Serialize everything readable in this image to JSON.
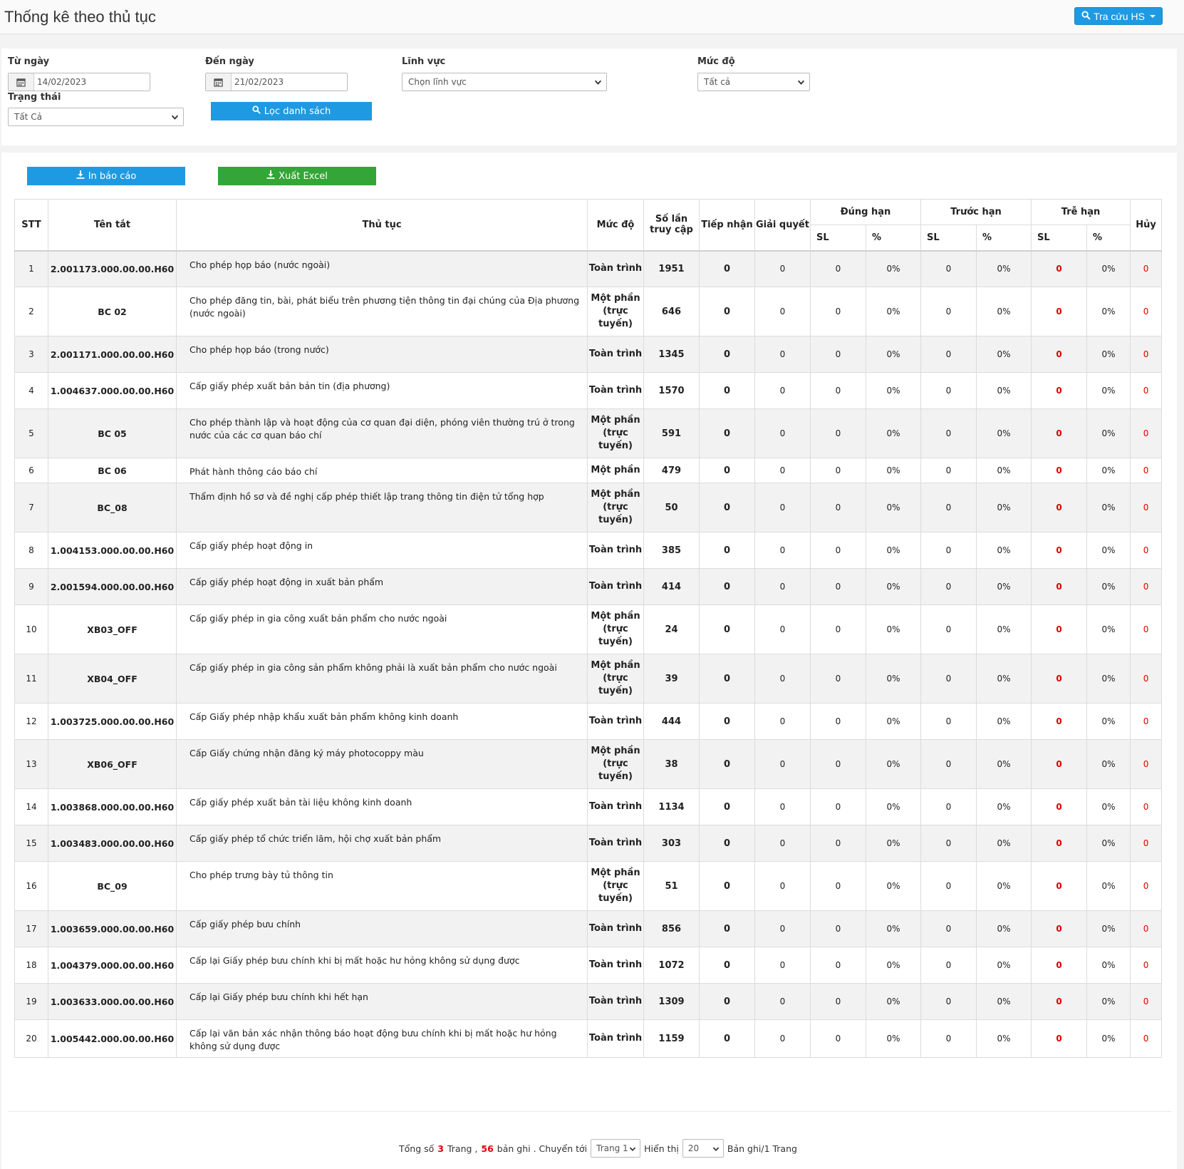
{
  "header": {
    "title": "Thống kê theo thủ tục",
    "lookup_button": "Tra cứu HS"
  },
  "filters": {
    "from_label": "Từ ngày",
    "from_value": "14/02/2023",
    "to_label": "Đến ngày",
    "to_value": "21/02/2023",
    "field_label": "Lĩnh vực",
    "field_value": "Chọn lĩnh vực",
    "level_label": "Mức độ",
    "level_value": "Tất cả",
    "status_label": "Trạng thái",
    "status_value": "Tất Cả",
    "filter_button": "Lọc danh sách"
  },
  "actions": {
    "print_button": "In báo cáo",
    "excel_button": "Xuất Excel"
  },
  "table": {
    "headers": {
      "stt": "STT",
      "code": "Tên tắt",
      "procedure": "Thủ tục",
      "level": "Mức độ",
      "access": "Số lần truy cập",
      "received": "Tiếp nhận",
      "resolved": "Giải quyết",
      "ontime": "Đúng hạn",
      "early": "Trước hạn",
      "late": "Trễ hạn",
      "cancel": "Hủy",
      "sl": "SL",
      "pct": "%"
    },
    "rows": [
      {
        "stt": "1",
        "code": "2.001173.000.00.00.H60",
        "procedure": "Cho phép họp báo (nước ngoài)",
        "level": "Toàn trình",
        "access": "1951",
        "received": "0",
        "resolved": "0",
        "ontime_sl": "0",
        "ontime_pct": "0%",
        "early_sl": "0",
        "early_pct": "0%",
        "late_sl": "0",
        "late_pct": "0%",
        "cancel": "0"
      },
      {
        "stt": "2",
        "code": "BC 02",
        "procedure": "Cho phép đăng tin, bài, phát biểu trên phương tiện thông tin đại chúng của Địa phương (nước ngoài)",
        "level": "Một phần (trực tuyến)",
        "access": "646",
        "received": "0",
        "resolved": "0",
        "ontime_sl": "0",
        "ontime_pct": "0%",
        "early_sl": "0",
        "early_pct": "0%",
        "late_sl": "0",
        "late_pct": "0%",
        "cancel": "0"
      },
      {
        "stt": "3",
        "code": "2.001171.000.00.00.H60",
        "procedure": "Cho phép họp báo (trong nước)",
        "level": "Toàn trình",
        "access": "1345",
        "received": "0",
        "resolved": "0",
        "ontime_sl": "0",
        "ontime_pct": "0%",
        "early_sl": "0",
        "early_pct": "0%",
        "late_sl": "0",
        "late_pct": "0%",
        "cancel": "0"
      },
      {
        "stt": "4",
        "code": "1.004637.000.00.00.H60",
        "procedure": "Cấp giấy phép xuất bản bản tin (địa phương)",
        "level": "Toàn trình",
        "access": "1570",
        "received": "0",
        "resolved": "0",
        "ontime_sl": "0",
        "ontime_pct": "0%",
        "early_sl": "0",
        "early_pct": "0%",
        "late_sl": "0",
        "late_pct": "0%",
        "cancel": "0"
      },
      {
        "stt": "5",
        "code": "BC 05",
        "procedure": "Cho phép thành lập và hoạt động của cơ quan đại diện, phóng viên thường trú ở trong nước của các cơ quan báo chí",
        "level": "Một phần (trực tuyến)",
        "access": "591",
        "received": "0",
        "resolved": "0",
        "ontime_sl": "0",
        "ontime_pct": "0%",
        "early_sl": "0",
        "early_pct": "0%",
        "late_sl": "0",
        "late_pct": "0%",
        "cancel": "0"
      },
      {
        "stt": "6",
        "code": "BC 06",
        "procedure": "Phát hành thông cáo báo chí",
        "level": "Một phần",
        "access": "479",
        "received": "0",
        "resolved": "0",
        "ontime_sl": "0",
        "ontime_pct": "0%",
        "early_sl": "0",
        "early_pct": "0%",
        "late_sl": "0",
        "late_pct": "0%",
        "cancel": "0"
      },
      {
        "stt": "7",
        "code": "BC_08",
        "procedure": "Thẩm định hồ sơ và đề nghị cấp phép thiết lập trang thông tin điện tử tổng hợp",
        "level": "Một phần (trực tuyến)",
        "access": "50",
        "received": "0",
        "resolved": "0",
        "ontime_sl": "0",
        "ontime_pct": "0%",
        "early_sl": "0",
        "early_pct": "0%",
        "late_sl": "0",
        "late_pct": "0%",
        "cancel": "0"
      },
      {
        "stt": "8",
        "code": "1.004153.000.00.00.H60",
        "procedure": "Cấp giấy phép hoạt động in",
        "level": "Toàn trình",
        "access": "385",
        "received": "0",
        "resolved": "0",
        "ontime_sl": "0",
        "ontime_pct": "0%",
        "early_sl": "0",
        "early_pct": "0%",
        "late_sl": "0",
        "late_pct": "0%",
        "cancel": "0"
      },
      {
        "stt": "9",
        "code": "2.001594.000.00.00.H60",
        "procedure": "Cấp giấy phép hoạt động in xuất bản phẩm",
        "level": "Toàn trình",
        "access": "414",
        "received": "0",
        "resolved": "0",
        "ontime_sl": "0",
        "ontime_pct": "0%",
        "early_sl": "0",
        "early_pct": "0%",
        "late_sl": "0",
        "late_pct": "0%",
        "cancel": "0"
      },
      {
        "stt": "10",
        "code": "XB03_OFF",
        "procedure": "Cấp giấy phép in gia công xuất bản phẩm cho nước ngoài",
        "level": "Một phần (trực tuyến)",
        "access": "24",
        "received": "0",
        "resolved": "0",
        "ontime_sl": "0",
        "ontime_pct": "0%",
        "early_sl": "0",
        "early_pct": "0%",
        "late_sl": "0",
        "late_pct": "0%",
        "cancel": "0"
      },
      {
        "stt": "11",
        "code": "XB04_OFF",
        "procedure": "Cấp giấy phép in gia công sản phẩm không phải là xuất bản phẩm cho nước ngoài",
        "level": "Một phần (trực tuyến)",
        "access": "39",
        "received": "0",
        "resolved": "0",
        "ontime_sl": "0",
        "ontime_pct": "0%",
        "early_sl": "0",
        "early_pct": "0%",
        "late_sl": "0",
        "late_pct": "0%",
        "cancel": "0"
      },
      {
        "stt": "12",
        "code": "1.003725.000.00.00.H60",
        "procedure": "Cấp Giấy phép nhập khẩu xuất bản phẩm không kinh doanh",
        "level": "Toàn trình",
        "access": "444",
        "received": "0",
        "resolved": "0",
        "ontime_sl": "0",
        "ontime_pct": "0%",
        "early_sl": "0",
        "early_pct": "0%",
        "late_sl": "0",
        "late_pct": "0%",
        "cancel": "0"
      },
      {
        "stt": "13",
        "code": "XB06_OFF",
        "procedure": "Cấp Giấy chứng nhận đăng ký máy photocoppy màu",
        "level": "Một phần (trực tuyến)",
        "access": "38",
        "received": "0",
        "resolved": "0",
        "ontime_sl": "0",
        "ontime_pct": "0%",
        "early_sl": "0",
        "early_pct": "0%",
        "late_sl": "0",
        "late_pct": "0%",
        "cancel": "0"
      },
      {
        "stt": "14",
        "code": "1.003868.000.00.00.H60",
        "procedure": "Cấp giấy phép xuất bản tài liệu không kinh doanh",
        "level": "Toàn trình",
        "access": "1134",
        "received": "0",
        "resolved": "0",
        "ontime_sl": "0",
        "ontime_pct": "0%",
        "early_sl": "0",
        "early_pct": "0%",
        "late_sl": "0",
        "late_pct": "0%",
        "cancel": "0"
      },
      {
        "stt": "15",
        "code": "1.003483.000.00.00.H60",
        "procedure": "Cấp giấy phép tổ chức triển lãm, hội chợ xuất bản phẩm",
        "level": "Toàn trình",
        "access": "303",
        "received": "0",
        "resolved": "0",
        "ontime_sl": "0",
        "ontime_pct": "0%",
        "early_sl": "0",
        "early_pct": "0%",
        "late_sl": "0",
        "late_pct": "0%",
        "cancel": "0"
      },
      {
        "stt": "16",
        "code": "BC_09",
        "procedure": "Cho phép trưng bày tủ thông tin",
        "level": "Một phần (trực tuyến)",
        "access": "51",
        "received": "0",
        "resolved": "0",
        "ontime_sl": "0",
        "ontime_pct": "0%",
        "early_sl": "0",
        "early_pct": "0%",
        "late_sl": "0",
        "late_pct": "0%",
        "cancel": "0"
      },
      {
        "stt": "17",
        "code": "1.003659.000.00.00.H60",
        "procedure": "Cấp giấy phép bưu chính",
        "level": "Toàn trình",
        "access": "856",
        "received": "0",
        "resolved": "0",
        "ontime_sl": "0",
        "ontime_pct": "0%",
        "early_sl": "0",
        "early_pct": "0%",
        "late_sl": "0",
        "late_pct": "0%",
        "cancel": "0"
      },
      {
        "stt": "18",
        "code": "1.004379.000.00.00.H60",
        "procedure": "Cấp lại Giấy phép bưu chính khi bị mất hoặc hư hỏng không sử dụng được",
        "level": "Toàn trình",
        "access": "1072",
        "received": "0",
        "resolved": "0",
        "ontime_sl": "0",
        "ontime_pct": "0%",
        "early_sl": "0",
        "early_pct": "0%",
        "late_sl": "0",
        "late_pct": "0%",
        "cancel": "0"
      },
      {
        "stt": "19",
        "code": "1.003633.000.00.00.H60",
        "procedure": "Cấp lại Giấy phép bưu chính khi hết hạn",
        "level": "Toàn trình",
        "access": "1309",
        "received": "0",
        "resolved": "0",
        "ontime_sl": "0",
        "ontime_pct": "0%",
        "early_sl": "0",
        "early_pct": "0%",
        "late_sl": "0",
        "late_pct": "0%",
        "cancel": "0"
      },
      {
        "stt": "20",
        "code": "1.005442.000.00.00.H60",
        "procedure": "Cấp lại văn bản xác nhận thông báo hoạt động bưu chính khi bị mất hoặc hư hỏng không sử dụng được",
        "level": "Toàn trình",
        "access": "1159",
        "received": "0",
        "resolved": "0",
        "ontime_sl": "0",
        "ontime_pct": "0%",
        "early_sl": "0",
        "early_pct": "0%",
        "late_sl": "0",
        "late_pct": "0%",
        "cancel": "0"
      }
    ]
  },
  "pager": {
    "total_prefix": "Tổng số",
    "total_pages": "3",
    "pages_word": "Trang ,",
    "total_records": "56",
    "records_word": "bản ghi . Chuyển tới",
    "page_select": "Trang 1",
    "show_label": "Hiển thị",
    "per_page": "20",
    "per_page_suffix": "Bản ghi/1 Trang"
  }
}
